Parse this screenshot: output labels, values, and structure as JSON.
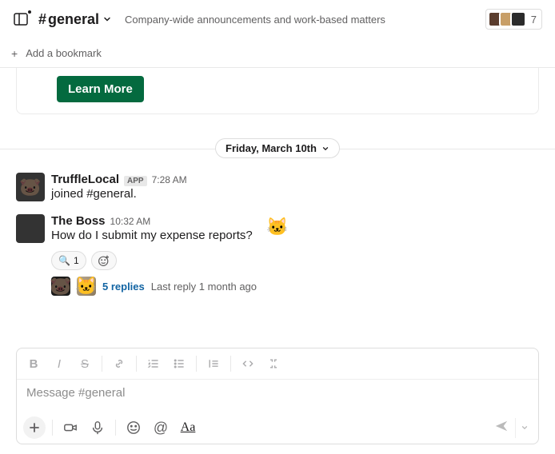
{
  "header": {
    "channel_name": "general",
    "topic": "Company-wide announcements and work-based matters",
    "member_count": "7"
  },
  "bookmark": {
    "label": "Add a bookmark"
  },
  "card": {
    "button_label": "Learn More"
  },
  "date_divider": "Friday, March 10th",
  "messages": [
    {
      "name": "TruffleLocal",
      "badge": "APP",
      "time": "7:28 AM",
      "text": "joined #general."
    },
    {
      "name": "The Boss",
      "time": "10:32 AM",
      "text": "How do I submit my expense reports?",
      "reaction_emoji": "🔍",
      "reaction_count": "1",
      "replies_label": "5 replies",
      "last_reply": "Last reply 1 month ago"
    }
  ],
  "composer": {
    "placeholder": "Message #general"
  }
}
